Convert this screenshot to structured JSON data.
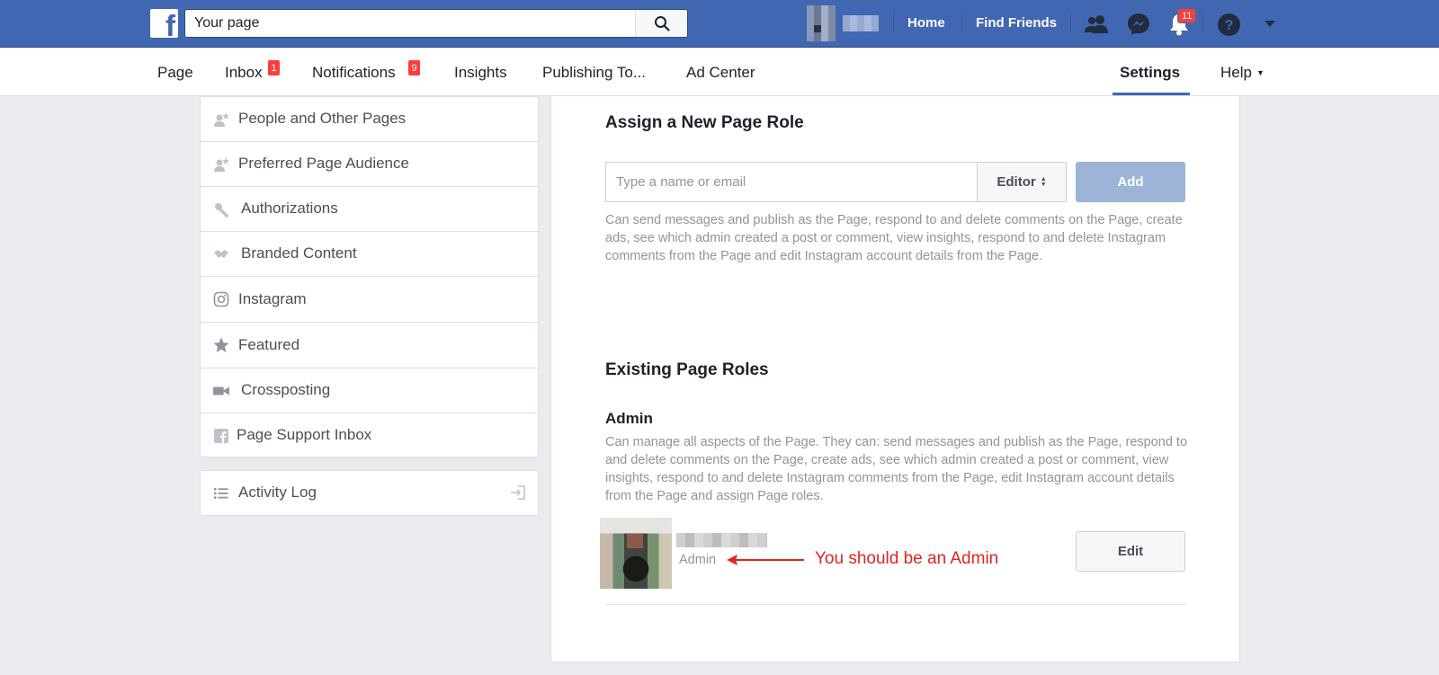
{
  "topbar": {
    "search_value": "Your page",
    "logo_letter": "f",
    "links": [
      "Home",
      "Find Friends"
    ],
    "notifications_count": "11"
  },
  "pagenav": {
    "items": [
      {
        "label": "Page"
      },
      {
        "label": "Inbox",
        "badge": "1"
      },
      {
        "label": "Notifications",
        "badge": "9"
      },
      {
        "label": "Insights"
      },
      {
        "label": "Publishing To..."
      },
      {
        "label": "Ad Center"
      }
    ],
    "settings": "Settings",
    "help": "Help"
  },
  "sidebar": {
    "items": [
      {
        "label": "People and Other Pages",
        "icon": "person-star-icon"
      },
      {
        "label": "Preferred Page Audience",
        "icon": "person-star-icon"
      },
      {
        "label": "Authorizations",
        "icon": "wrench-icon"
      },
      {
        "label": "Branded Content",
        "icon": "handshake-icon"
      },
      {
        "label": "Instagram",
        "icon": "instagram-icon"
      },
      {
        "label": "Featured",
        "icon": "star-icon"
      },
      {
        "label": "Crossposting",
        "icon": "video-camera-icon"
      },
      {
        "label": "Page Support Inbox",
        "icon": "facebook-square-icon"
      }
    ],
    "activity_log": "Activity Log"
  },
  "assign": {
    "title": "Assign a New Page Role",
    "placeholder": "Type a name or email",
    "role_selected": "Editor",
    "add_label": "Add",
    "description": "Can send messages and publish as the Page, respond to and delete comments on the Page, create ads, see which admin created a post or comment, view insights, respond to and delete Instagram comments from the Page and edit Instagram account details from the Page."
  },
  "existing": {
    "title": "Existing Page Roles",
    "role_title": "Admin",
    "role_description": "Can manage all aspects of the Page. They can: send messages and publish as the Page, respond to and delete comments on the Page, create ads, see which admin created a post or comment, view insights, respond to and delete Instagram comments from the Page, edit Instagram account details from the Page and assign Page roles.",
    "user_role": "Admin",
    "annotation": "You should be an Admin",
    "edit_label": "Edit"
  },
  "colors": {
    "brand_blue": "#4267b2",
    "badge_red": "#fa3e3e",
    "annotation_red": "#e02424"
  }
}
